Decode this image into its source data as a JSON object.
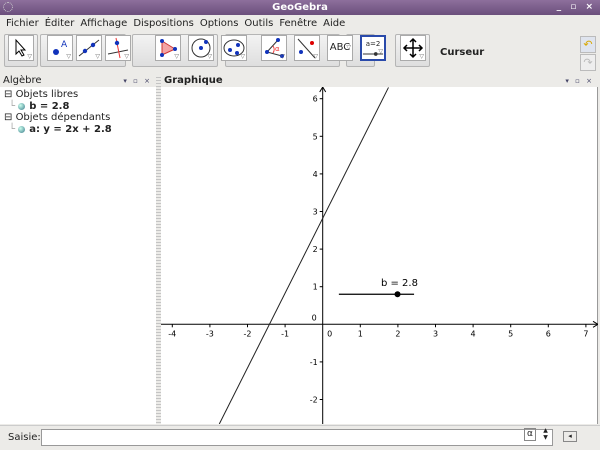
{
  "window": {
    "title": "GeoGebra",
    "controls": "_ ▫ ×"
  },
  "menu": [
    "Fichier",
    "Éditer",
    "Affichage",
    "Dispositions",
    "Options",
    "Outils",
    "Fenêtre",
    "Aide"
  ],
  "toolbar": {
    "current_tool": "Curseur",
    "text_tool_label": "ABC",
    "slider_tool_label": "a=2"
  },
  "algebra": {
    "title": "Algèbre",
    "free_header": "Objets libres",
    "free": [
      "b = 2.8"
    ],
    "dependent_header": "Objets dépendants",
    "dependent": [
      "a: y = 2x + 2.8"
    ]
  },
  "graphics": {
    "title": "Graphique",
    "slider_label": "b = 2.8",
    "x_ticks": [
      -4,
      -3,
      -2,
      -1,
      0,
      1,
      2,
      3,
      4,
      5,
      6,
      7
    ],
    "y_ticks": [
      -2,
      -1,
      0,
      1,
      2,
      3,
      4,
      5,
      6
    ]
  },
  "chart_data": {
    "type": "line",
    "series": [
      {
        "name": "a",
        "slope": 2,
        "intercept": 2.8
      }
    ],
    "slider": {
      "name": "b",
      "value": 2.8,
      "position_fraction": 0.78
    },
    "xlim": [
      -4.3,
      7.3
    ],
    "ylim": [
      -2.7,
      6.3
    ]
  },
  "inputbar": {
    "label": "Saisie:",
    "value": "",
    "alpha_button": "α",
    "spin": "▲▼",
    "keyboard": "◂"
  },
  "panel_controls": "▾ ▫ ×"
}
